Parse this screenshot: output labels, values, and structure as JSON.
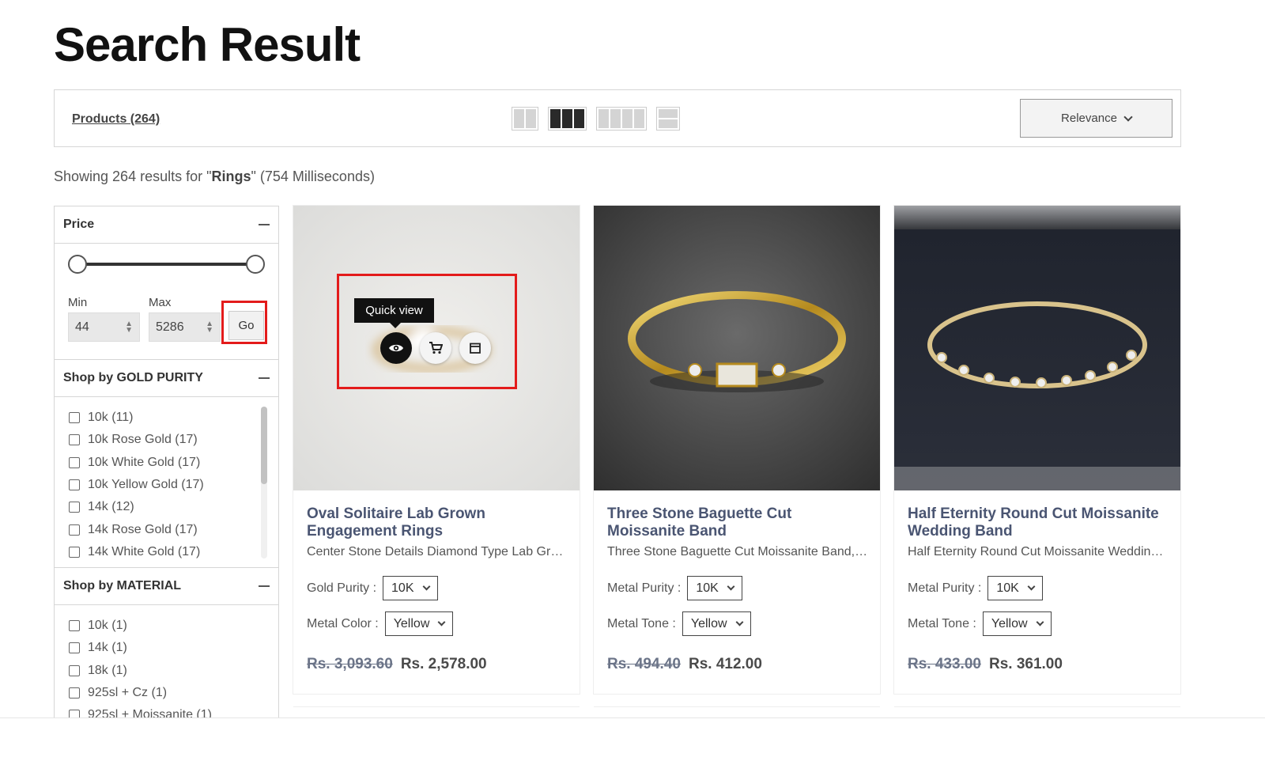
{
  "page": {
    "title": "Search Result"
  },
  "toolbar": {
    "products_label": "Products (264)",
    "sort_label": "Relevance"
  },
  "results": {
    "prefix": "Showing 264 results for \"",
    "query": "Rings",
    "suffix": "\" (754 Milliseconds)"
  },
  "filters": {
    "price": {
      "title": "Price",
      "min_label": "Min",
      "max_label": "Max",
      "min_value": "44",
      "max_value": "5286",
      "go_label": "Go"
    },
    "gold_purity": {
      "title": "Shop by GOLD PURITY",
      "items": [
        "10k (11)",
        "10k Rose Gold (17)",
        "10k White Gold (17)",
        "10k Yellow Gold (17)",
        "14k (12)",
        "14k Rose Gold (17)",
        "14k White Gold (17)"
      ]
    },
    "material": {
      "title": "Shop by MATERIAL",
      "items": [
        "10k (1)",
        "14k (1)",
        "18k (1)",
        "925sl + Cz (1)",
        "925sl + Moissanite (1)"
      ]
    }
  },
  "quick_view": {
    "tooltip": "Quick view"
  },
  "products": [
    {
      "title": "Oval Solitaire Lab Grown Engagement Rings",
      "desc": "Center Stone Details Diamond Type Lab Grown Diamond",
      "opt1_label": "Gold Purity :",
      "opt1_value": "10K",
      "opt2_label": "Metal Color :",
      "opt2_value": "Yellow",
      "price_old": "Rs. 3,093.60",
      "price_new": "Rs. 2,578.00"
    },
    {
      "title": "Three Stone Baguette Cut Moissanite Band",
      "desc": "Three Stone Baguette Cut Moissanite Band, Minimalist",
      "opt1_label": "Metal Purity :",
      "opt1_value": "10K",
      "opt2_label": "Metal Tone :",
      "opt2_value": "Yellow",
      "price_old": "Rs. 494.40",
      "price_new": "Rs. 412.00"
    },
    {
      "title": "Half Eternity Round Cut Moissanite Wedding Band",
      "desc": "Half Eternity Round Cut Moissanite Wedding Band for Women",
      "opt1_label": "Metal Purity :",
      "opt1_value": "10K",
      "opt2_label": "Metal Tone :",
      "opt2_value": "Yellow",
      "price_old": "Rs. 433.00",
      "price_new": "Rs. 361.00"
    }
  ]
}
